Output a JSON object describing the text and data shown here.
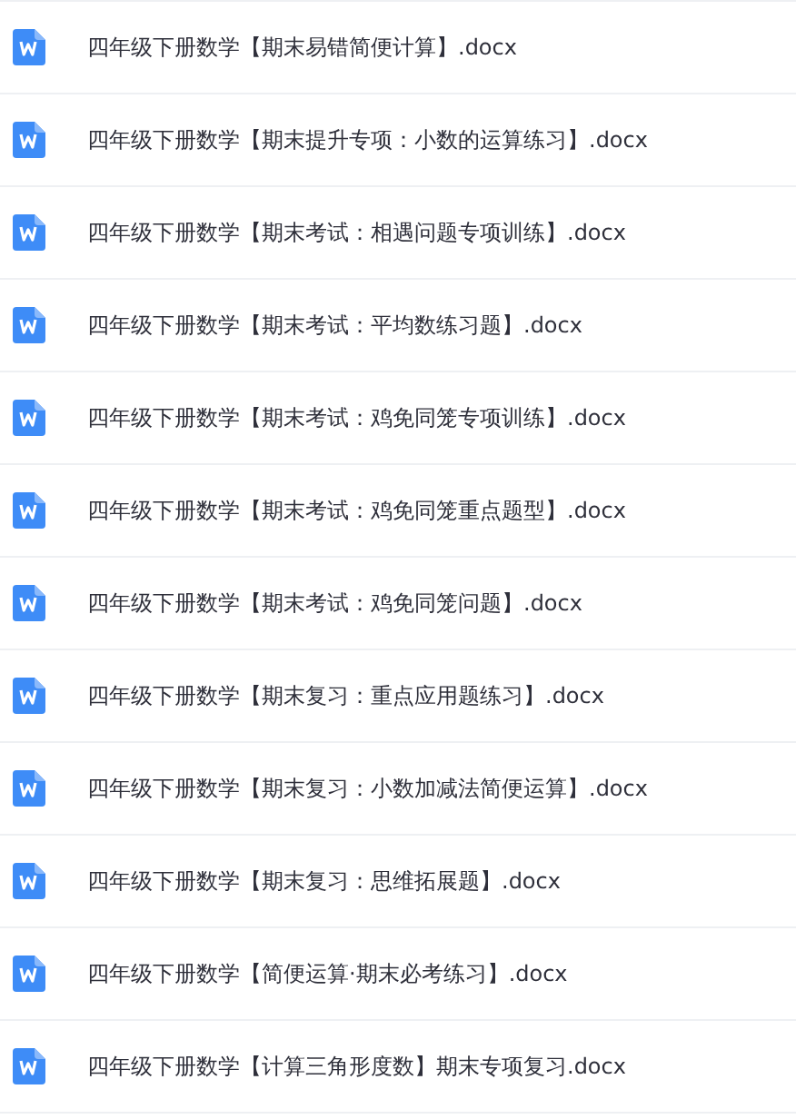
{
  "files": [
    {
      "name": "四年级下册数学【期末易错简便计算】.docx"
    },
    {
      "name": "四年级下册数学【期末提升专项：小数的运算练习】.docx"
    },
    {
      "name": "四年级下册数学【期末考试：相遇问题专项训练】.docx"
    },
    {
      "name": "四年级下册数学【期末考试：平均数练习题】.docx"
    },
    {
      "name": "四年级下册数学【期末考试：鸡免同笼专项训练】.docx"
    },
    {
      "name": "四年级下册数学【期末考试：鸡免同笼重点题型】.docx"
    },
    {
      "name": "四年级下册数学【期末考试：鸡免同笼问题】.docx"
    },
    {
      "name": "四年级下册数学【期末复习：重点应用题练习】.docx"
    },
    {
      "name": "四年级下册数学【期末复习：小数加减法简便运算】.docx"
    },
    {
      "name": "四年级下册数学【期末复习：思维拓展题】.docx"
    },
    {
      "name": "四年级下册数学【简便运算·期末必考练习】.docx"
    },
    {
      "name": "四年级下册数学【计算三角形度数】期末专项复习.docx"
    }
  ]
}
